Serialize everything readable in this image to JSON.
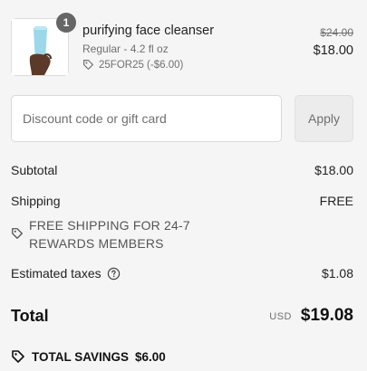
{
  "product": {
    "quantity": "1",
    "name": "purifying face cleanser",
    "variant": "Regular - 4.2 fl oz",
    "discount": "25FOR25 (-$6.00)",
    "compare_price": "$24.00",
    "price": "$18.00",
    "image_icon": "tube-in-hand-image"
  },
  "discount_code": {
    "placeholder": "Discount code or gift card",
    "value": "",
    "apply_label": "Apply"
  },
  "summary": {
    "subtotal_label": "Subtotal",
    "subtotal_value": "$18.00",
    "shipping_label": "Shipping",
    "shipping_value": "FREE",
    "shipping_note_line1": "FREE SHIPPING FOR 24-7",
    "shipping_note_line2": "REWARDS MEMBERS",
    "taxes_label": "Estimated taxes",
    "taxes_value": "$1.08",
    "total_label": "Total",
    "currency": "USD",
    "total_value": "$19.08",
    "savings_label": "TOTAL SAVINGS",
    "savings_value": "$6.00"
  },
  "colors": {
    "background": "#f5f5f5",
    "text": "#1f1f1f",
    "muted": "#707070",
    "badge": "#666666",
    "tube": "#8fd3e6"
  },
  "icons": [
    "tag-icon",
    "help-circle-icon"
  ]
}
